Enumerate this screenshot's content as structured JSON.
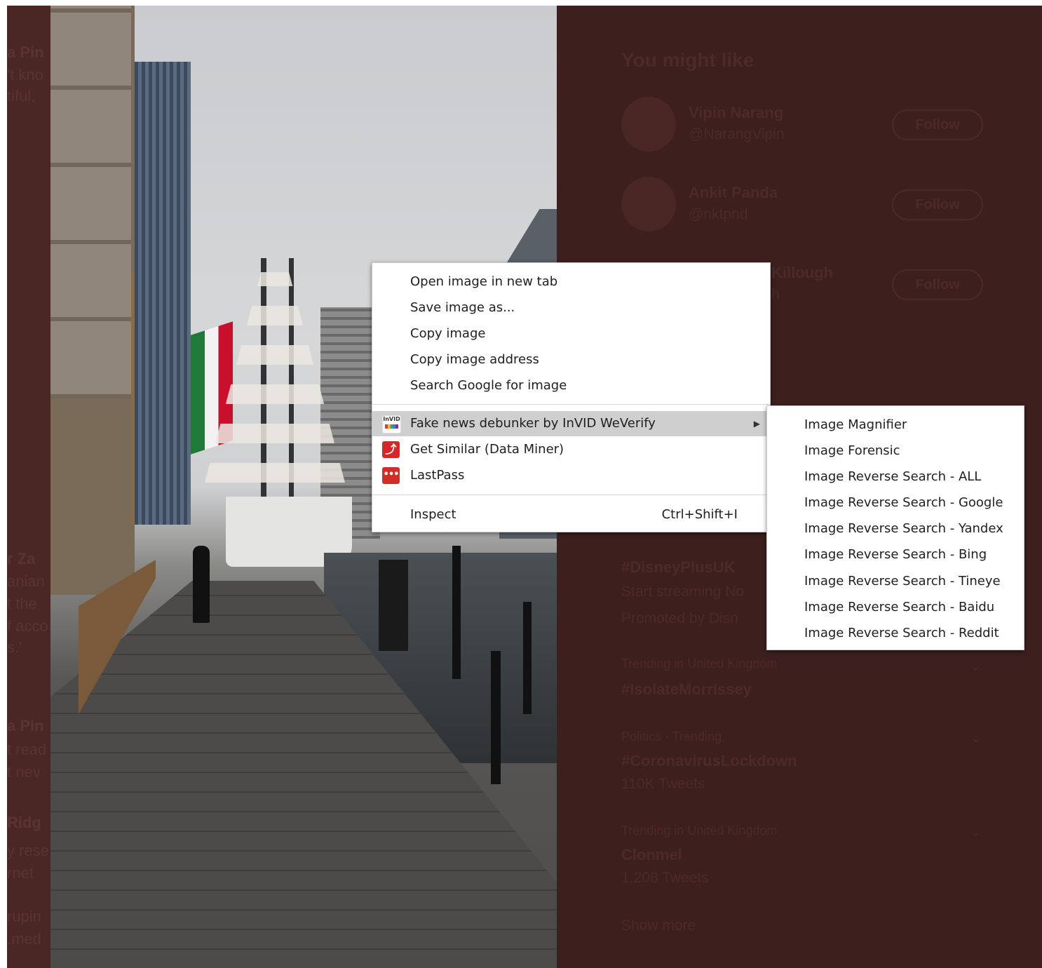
{
  "left_column": {
    "snippets": [
      "a Pin",
      "'t kno",
      "tiful,",
      "r Za",
      "anian",
      "t the",
      "f acco",
      "s.'",
      "a Pin",
      "t read",
      "t nev",
      "Ridg",
      "y rese",
      "rnet",
      "rupin",
      ".med"
    ]
  },
  "right_sidebar": {
    "you_might_like": "You might like",
    "accounts": [
      {
        "name": "Vipin Narang",
        "handle": "@NarangVipin",
        "follow": "Follow"
      },
      {
        "name": "Ankit Panda",
        "handle": "@nktpnd",
        "follow": "Follow"
      },
      {
        "name": "Killough",
        "handle": "h",
        "follow": "Follow"
      }
    ],
    "trends": [
      {
        "context": "",
        "tag": "#DisneyPlusUK",
        "sub": "Start streaming No",
        "promoted": "Promoted by Disn"
      },
      {
        "context": "Trending in United Kingdom",
        "tag": "#IsolateMorrissey",
        "sub": ""
      },
      {
        "context": "Politics · Trending",
        "tag": "#CoronavirusLockdown",
        "sub": "110K Tweets"
      },
      {
        "context": "Trending in United Kingdom",
        "tag": "Clonmel",
        "sub": "1,208 Tweets"
      }
    ],
    "show_more": "Show more"
  },
  "context_menu": {
    "items": [
      {
        "label": "Open image in new tab"
      },
      {
        "label": "Save image as..."
      },
      {
        "label": "Copy image"
      },
      {
        "label": "Copy image address"
      },
      {
        "label": "Search Google for image"
      }
    ],
    "extensions": [
      {
        "label": "Fake news debunker by InVID  WeVerify",
        "icon": "invid-icon",
        "icon_text": "InVID",
        "has_submenu": true
      },
      {
        "label": "Get Similar (Data Miner)",
        "icon": "data-miner-icon"
      },
      {
        "label": "LastPass",
        "icon": "lastpass-icon",
        "icon_text": "•••"
      }
    ],
    "inspect": {
      "label": "Inspect",
      "shortcut": "Ctrl+Shift+I"
    }
  },
  "submenu": {
    "items": [
      "Image Magnifier",
      "Image Forensic",
      "Image Reverse Search - ALL",
      "Image Reverse Search - Google",
      "Image Reverse Search - Yandex",
      "Image Reverse Search - Bing",
      "Image Reverse Search - Tineye",
      "Image Reverse Search - Baidu",
      "Image Reverse Search - Reddit"
    ]
  },
  "colors": {
    "overlay": "#3d1f1e",
    "menu_bg": "#ffffff",
    "highlight": "#cfcfcf",
    "text": "#202020"
  }
}
